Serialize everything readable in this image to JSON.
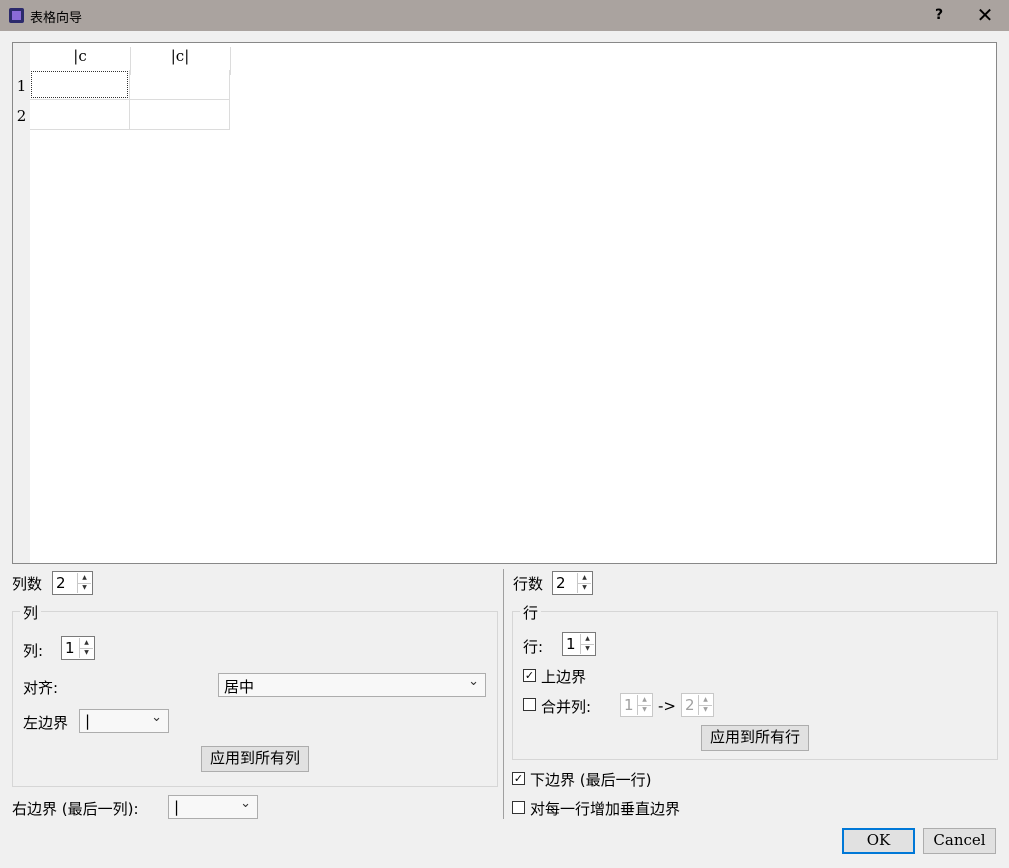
{
  "window": {
    "title": "表格向导",
    "help": "?",
    "close": "✕"
  },
  "table": {
    "col_headers": [
      "|c",
      "|c|"
    ],
    "row_numbers": [
      "1",
      "2"
    ]
  },
  "columns": {
    "count_label": "列数",
    "count": "2",
    "group_title": "列",
    "column_label": "列:",
    "column_value": "1",
    "align_label": "对齐:",
    "align_value": "居中",
    "left_border_label": "左边界",
    "left_border_value": "|",
    "apply_all": "应用到所有列",
    "right_border_label": "右边界 (最后一列):",
    "right_border_value": "|"
  },
  "rows": {
    "count_label": "行数",
    "count": "2",
    "group_title": "行",
    "row_label": "行:",
    "row_value": "1",
    "top_border_label": "上边界",
    "top_border_checked": true,
    "merge_label": "合并列:",
    "merge_checked": false,
    "merge_from": "1",
    "merge_arrow": "->",
    "merge_to": "2",
    "apply_all": "应用到所有行",
    "bottom_border_label": "下边界 (最后一行)",
    "bottom_border_checked": true,
    "vertical_border_label": "对每一行增加垂直边界",
    "vertical_border_checked": false
  },
  "buttons": {
    "ok": "OK",
    "cancel": "Cancel"
  },
  "icons": {
    "check": "☑",
    "chevron": "chevron-down-icon"
  }
}
